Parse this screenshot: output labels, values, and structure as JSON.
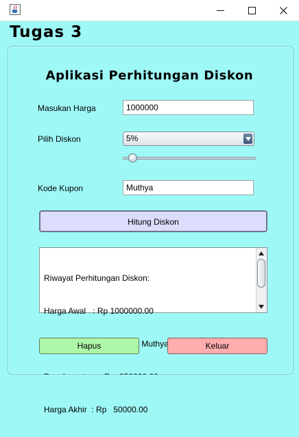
{
  "window": {
    "icon": "java-cup-icon",
    "controls": {
      "minimize": "minimize-icon",
      "maximize": "maximize-icon",
      "close": "close-icon"
    }
  },
  "app_title": "Tugas 3",
  "form": {
    "title": "Aplikasi Perhitungan Diskon",
    "harga_label": "Masukan Harga",
    "harga_value": "1000000",
    "diskon_label": "Pilih Diskon",
    "diskon_selected": "5%",
    "slider_value": 5,
    "kupon_label": "Kode Kupon",
    "kupon_value": "Muthya",
    "hitung_button": "Hitung Diskon"
  },
  "history": {
    "lines": [
      "Riwayat Perhitungan Diskon:",
      "Harga Awal   : Rp 1000000.00",
      "Diskon       :  5% + Kupon: Muthya     (90%)",
      "Penghematan  : Rp  950000.00",
      "Harga Akhir  : Rp   50000.00"
    ]
  },
  "buttons": {
    "hapus": "Hapus",
    "keluar": "Keluar"
  },
  "colors": {
    "background": "#9ef8f6",
    "hitung_button": "#dcdcfd",
    "hapus_button": "#aef7a8",
    "keluar_button": "#ffadad"
  }
}
